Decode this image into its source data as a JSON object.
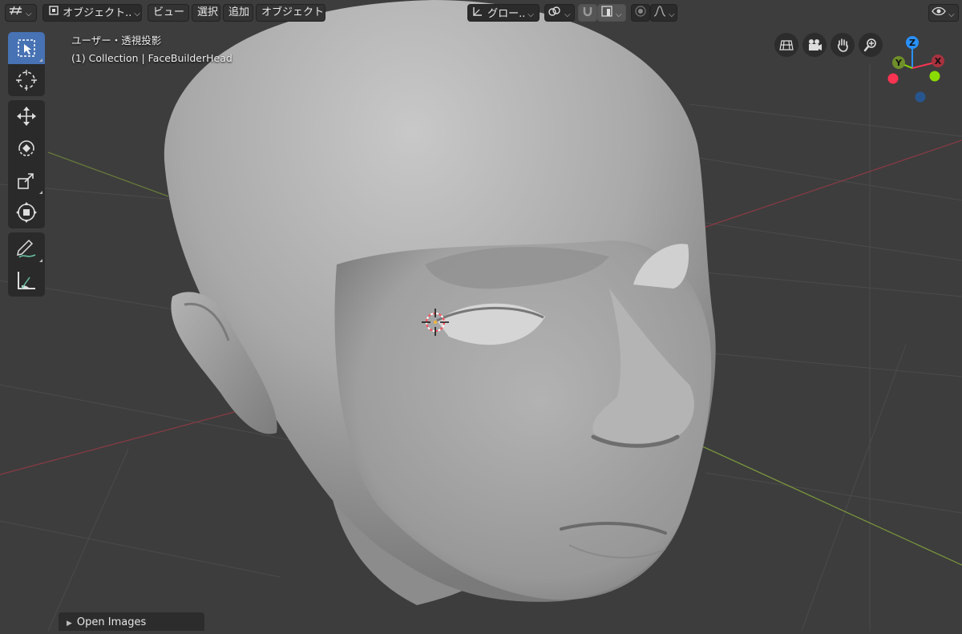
{
  "header": {
    "editor_type_icon": "editor-type-icon",
    "mode_label": "オブジェクト..",
    "menu": {
      "view": "ビュー",
      "select": "選択",
      "add": "追加",
      "object": "オブジェクト"
    },
    "orientation_label": "グロー..",
    "icons": [
      "transform-orientation-icon",
      "snap-link-icon",
      "snap-magnet-icon",
      "snap-increment-icon",
      "proportional-edit-icon",
      "falloff-curve-icon",
      "visibility-eye-icon"
    ]
  },
  "toolbar": {
    "tools": [
      "select-box",
      "cursor",
      "move",
      "rotate",
      "scale",
      "transform",
      "annotate",
      "measure"
    ],
    "active": "select-box"
  },
  "viewport_info": {
    "view_name": "ユーザー・透視投影",
    "collection_line": "(1) Collection | FaceBuilderHead"
  },
  "navigation": {
    "buttons": [
      "toggle-ortho-icon",
      "camera-view-icon",
      "pan-hand-icon",
      "zoom-icon"
    ]
  },
  "gizmo": {
    "x_label": "X",
    "y_label": "Y",
    "z_label": "Z",
    "colors": {
      "x": "#ff3352",
      "y": "#8bdc00",
      "z": "#2890ff"
    }
  },
  "footer": {
    "open_images_label": "Open Images"
  },
  "scene": {
    "object_name": "FaceBuilderHead",
    "object_color": "#a9a9a9",
    "grid_color": "#4a4a4a"
  }
}
